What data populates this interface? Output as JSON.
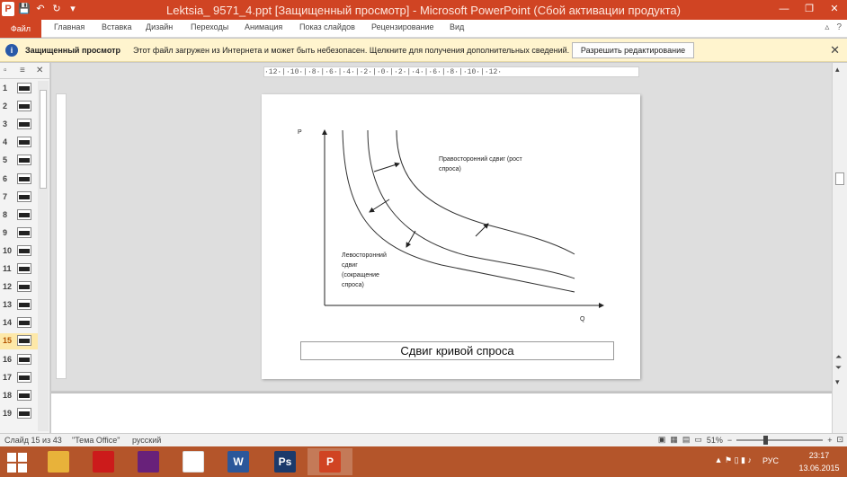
{
  "window": {
    "title": "Lektsia_ 9571_4.ppt [Защищенный просмотр] - Microsoft PowerPoint (Сбой активации продукта)"
  },
  "qat": {
    "logo": "P",
    "save": "💾",
    "undo": "↶",
    "redo": "↻",
    "customize": "▾"
  },
  "winctl": {
    "minimize": "—",
    "restore": "❐",
    "close": "✕"
  },
  "ribbon": {
    "file_tab": "Файл",
    "tabs": [
      "Главная",
      "Вставка",
      "Дизайн",
      "Переходы",
      "Анимация",
      "Показ слайдов",
      "Рецензирование",
      "Вид"
    ],
    "collapse_icon": "▵",
    "help_icon": "?"
  },
  "message_bar": {
    "title": "Защищенный просмотр",
    "text": "Этот файл загружен из Интернета и может быть небезопасен. Щелкните для получения дополнительных сведений.",
    "button": "Разрешить редактирование",
    "close": "✕"
  },
  "slide_pane": {
    "slides": [
      "1",
      "2",
      "3",
      "4",
      "5",
      "6",
      "7",
      "8",
      "9",
      "10",
      "11",
      "12",
      "13",
      "14",
      "15",
      "16",
      "17",
      "18",
      "19"
    ],
    "selected_index": 14,
    "close_icon": "✕"
  },
  "ruler_text": "·12·|·10·|·8·|·6·|·4·|·2·|·0·|·2·|·4·|·6·|·8·|·10·|·12·",
  "slide": {
    "y_axis": "P",
    "x_axis": "Q",
    "label_right": [
      "Правосторонний сдвиг (рост",
      "спроса)"
    ],
    "label_left": [
      "Левосторонний",
      "сдвиг",
      "(сокращение",
      "спроса)"
    ],
    "caption": "Сдвиг кривой спроса"
  },
  "status": {
    "slide_info": "Слайд 15 из 43",
    "theme": "\"Тема Office\"",
    "language": "русский",
    "zoom": "51%",
    "zoom_minus": "−",
    "zoom_plus": "+"
  },
  "taskbar": {
    "apps": [
      {
        "name": "file-explorer",
        "color": "#e8b23a"
      },
      {
        "name": "opera",
        "color": "#cc1b1b"
      },
      {
        "name": "visual-studio",
        "color": "#68217a"
      },
      {
        "name": "document",
        "color": "#ffffff"
      },
      {
        "name": "word",
        "color": "#2b579a"
      },
      {
        "name": "photoshop",
        "color": "#1b3a6b"
      },
      {
        "name": "powerpoint",
        "color": "#d04423"
      }
    ],
    "app_labels": {
      "word": "W",
      "photoshop": "Ps",
      "powerpoint": "P"
    },
    "language": "РУС",
    "time": "23:17",
    "date": "13.06.2015",
    "tray_icons": "▲ ⚑ ▯ ▮ ♪"
  },
  "colors": {
    "accent": "#d04423",
    "message_bar": "#fff4ce",
    "taskbar": "#b4552a"
  }
}
